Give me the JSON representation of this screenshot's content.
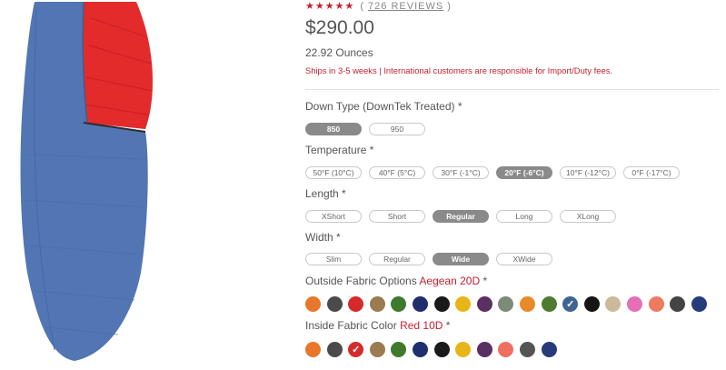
{
  "product": {
    "stars": "★★★★★",
    "reviews_open": "(",
    "reviews_text": "726 REVIEWS",
    "reviews_close": ")",
    "price": "$290.00",
    "weight": "22.92 Ounces",
    "shipping_notice": "Ships in 3-5 weeks | International customers are responsible for Import/Duty fees."
  },
  "down_type": {
    "label": "Down Type (DownTek Treated) *",
    "options": [
      {
        "label": "850",
        "selected": true
      },
      {
        "label": "950",
        "selected": false
      }
    ]
  },
  "temperature": {
    "label": "Temperature *",
    "options": [
      {
        "label": "50°F (10°C)",
        "selected": false
      },
      {
        "label": "40°F (5°C)",
        "selected": false
      },
      {
        "label": "30°F (-1°C)",
        "selected": false
      },
      {
        "label": "20°F (-6°C)",
        "selected": true
      },
      {
        "label": "10°F (-12°C)",
        "selected": false
      },
      {
        "label": "0°F (-17°C)",
        "selected": false
      }
    ]
  },
  "length": {
    "label": "Length *",
    "options": [
      {
        "label": "XShort",
        "selected": false
      },
      {
        "label": "Short",
        "selected": false
      },
      {
        "label": "Regular",
        "selected": true
      },
      {
        "label": "Long",
        "selected": false
      },
      {
        "label": "XLong",
        "selected": false
      }
    ]
  },
  "width": {
    "label": "Width *",
    "options": [
      {
        "label": "Slim",
        "selected": false
      },
      {
        "label": "Regular",
        "selected": false
      },
      {
        "label": "Wide",
        "selected": true
      },
      {
        "label": "XWide",
        "selected": false
      }
    ]
  },
  "outside_fabric": {
    "label": "Outside Fabric Options",
    "selected_name": "Aegean 20D",
    "required_mark": "*",
    "swatches": [
      {
        "color": "#e8772c",
        "selected": false
      },
      {
        "color": "#4a4a4a",
        "selected": false
      },
      {
        "color": "#d42a2a",
        "selected": false
      },
      {
        "color": "#9b7b4f",
        "selected": false
      },
      {
        "color": "#3f7a2c",
        "selected": false
      },
      {
        "color": "#1f2f6e",
        "selected": false
      },
      {
        "color": "#1a1a1a",
        "selected": false
      },
      {
        "color": "#e8b417",
        "selected": false
      },
      {
        "color": "#5a2f61",
        "selected": false
      },
      {
        "color": "#7d8a7a",
        "selected": false
      },
      {
        "color": "#e88a2a",
        "selected": false
      },
      {
        "color": "#4f7a32",
        "selected": false
      },
      {
        "color": "#3e6591",
        "selected": true
      },
      {
        "color": "#151515",
        "selected": false
      },
      {
        "color": "#cbb99a",
        "selected": false
      },
      {
        "color": "#e46fb4",
        "selected": false
      },
      {
        "color": "#ee7b5f",
        "selected": false
      },
      {
        "color": "#444444",
        "selected": false
      },
      {
        "color": "#263c7a",
        "selected": false
      }
    ]
  },
  "inside_fabric": {
    "label": "Inside Fabric Color",
    "selected_name": "Red 10D",
    "required_mark": "*",
    "swatches": [
      {
        "color": "#e8772c",
        "selected": false
      },
      {
        "color": "#4a4a4a",
        "selected": false
      },
      {
        "color": "#d42a2a",
        "selected": true
      },
      {
        "color": "#9b7b4f",
        "selected": false
      },
      {
        "color": "#3f7a2c",
        "selected": false
      },
      {
        "color": "#1f2f6e",
        "selected": false
      },
      {
        "color": "#1a1a1a",
        "selected": false
      },
      {
        "color": "#e8b417",
        "selected": false
      },
      {
        "color": "#5a2f61",
        "selected": false
      },
      {
        "color": "#ef6f5f",
        "selected": false
      },
      {
        "color": "#555555",
        "selected": false
      },
      {
        "color": "#263c7a",
        "selected": false
      }
    ]
  },
  "icons": {
    "check": "✓",
    "check_icon_name": "check-icon"
  }
}
